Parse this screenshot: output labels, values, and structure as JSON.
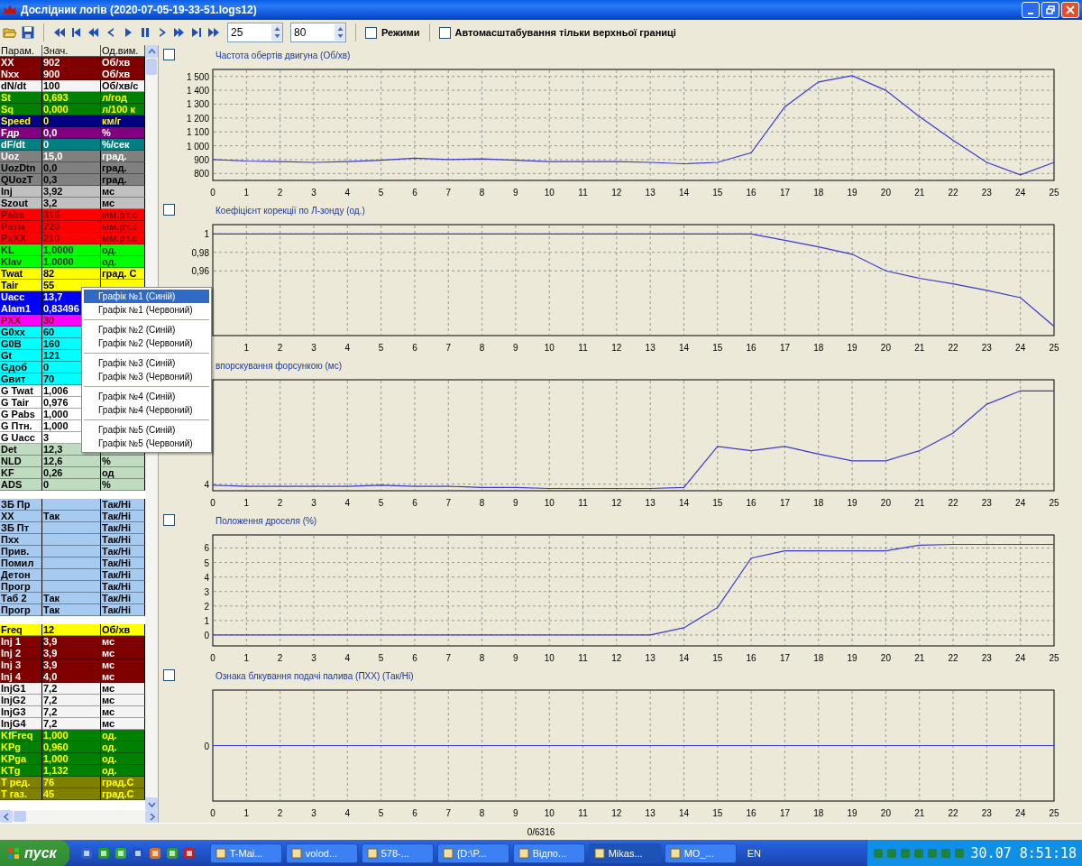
{
  "window": {
    "title": "Дослідник логів (2020-07-05-19-33-51.logs12)"
  },
  "toolbar": {
    "spin_fields": [
      {
        "value": "25"
      },
      {
        "value": "80"
      }
    ],
    "checkboxes": [
      {
        "label": "Режими",
        "checked": false
      },
      {
        "label": "Автомасштабування тільки верхньої границі",
        "checked": false
      }
    ]
  },
  "table": {
    "columns": [
      "Парам.",
      "Знач.",
      "Од.вим."
    ],
    "groups": [
      {
        "rows": [
          {
            "param": "XX",
            "value": "902",
            "unit": "Об/хв",
            "kind": "maroon"
          },
          {
            "param": "Nxx",
            "value": "900",
            "unit": "Об/хв",
            "kind": "maroon"
          },
          {
            "param": "dN/dt",
            "value": "100",
            "unit": "Об/хв/с",
            "kind": "light"
          },
          {
            "param": "St",
            "value": "0,693",
            "unit": "л/год",
            "kind": "green"
          },
          {
            "param": "Sq",
            "value": "0,000",
            "unit": "л/100 к",
            "kind": "green"
          },
          {
            "param": "Speed",
            "value": "0",
            "unit": "км/г",
            "kind": "navy"
          },
          {
            "param": "Fдр",
            "value": "0,0",
            "unit": "%",
            "kind": "purple"
          },
          {
            "param": "dF/dt",
            "value": "0",
            "unit": "%/сек",
            "kind": "teal"
          },
          {
            "param": "Uoz",
            "value": "15,0",
            "unit": "град.",
            "kind": "gray"
          },
          {
            "param": "UozDtn",
            "value": "0,0",
            "unit": "град.",
            "kind": "slate"
          },
          {
            "param": "QUozT",
            "value": "0,3",
            "unit": "град.",
            "kind": "slate"
          },
          {
            "param": "Inj",
            "value": "3,92",
            "unit": "мс",
            "kind": "silver"
          },
          {
            "param": "Szout",
            "value": "3,2",
            "unit": "мс",
            "kind": "silver"
          },
          {
            "param": "Pabs",
            "value": "315",
            "unit": "мм.рт.с",
            "kind": "red"
          },
          {
            "param": "Ратм",
            "value": "720",
            "unit": "мм.рт.с",
            "kind": "red"
          },
          {
            "param": "PxXX",
            "value": "210",
            "unit": "мм.рт.с",
            "kind": "red"
          },
          {
            "param": "KL",
            "value": "1,0000",
            "unit": "од.",
            "kind": "lime"
          },
          {
            "param": "Klav",
            "value": "1,0000",
            "unit": "од.",
            "kind": "lime"
          },
          {
            "param": "Twat",
            "value": "82",
            "unit": "град. С",
            "kind": "yellow"
          },
          {
            "param": "Tair",
            "value": "55",
            "kind": "yellow"
          },
          {
            "param": "Uacc",
            "value": "13,7",
            "kind": "blue"
          },
          {
            "param": "Alam1",
            "value": "0,83496",
            "kind": "blue"
          },
          {
            "param": "PXX",
            "value": "30",
            "kind": "magenta"
          },
          {
            "param": "G0xx",
            "value": "60",
            "kind": "cyan"
          },
          {
            "param": "G0B",
            "value": "160",
            "kind": "cyan"
          },
          {
            "param": "Gt",
            "value": "121",
            "kind": "cyan"
          },
          {
            "param": "Gдоб",
            "value": "0",
            "kind": "cyan"
          },
          {
            "param": "Gвит",
            "value": "70",
            "kind": "cyan"
          },
          {
            "param": "G Twat",
            "value": "1,006",
            "kind": "white"
          },
          {
            "param": "G Tair",
            "value": "0,976",
            "kind": "white"
          },
          {
            "param": "G Pabs",
            "value": "1,000",
            "kind": "white"
          },
          {
            "param": "G Птн.",
            "value": "1,000",
            "kind": "white"
          },
          {
            "param": "G Uacc",
            "value": "3",
            "kind": "white"
          },
          {
            "param": "Det",
            "value": "12,3",
            "kind": "sage"
          },
          {
            "param": "NLD",
            "value": "12,6",
            "unit": "%",
            "kind": "sage"
          },
          {
            "param": "KF",
            "value": "0,26",
            "unit": "од",
            "kind": "sage"
          },
          {
            "param": "ADS",
            "value": "0",
            "unit": "%",
            "kind": "sage"
          }
        ]
      },
      {
        "rows": [
          {
            "param": "ЗБ Пр",
            "unit": "Так/Ні",
            "kind": "sky"
          },
          {
            "param": "XX",
            "value": "Так",
            "unit": "Так/Ні",
            "kind": "sky"
          },
          {
            "param": "ЗБ Пт",
            "unit": "Так/Ні",
            "kind": "sky"
          },
          {
            "param": "Пхх",
            "unit": "Так/Ні",
            "kind": "sky"
          },
          {
            "param": "Прив.",
            "unit": "Так/Ні",
            "kind": "sky"
          },
          {
            "param": "Помил",
            "unit": "Так/Ні",
            "kind": "sky"
          },
          {
            "param": "Детон",
            "unit": "Так/Ні",
            "kind": "sky"
          },
          {
            "param": "Прогр",
            "unit": "Так/Ні",
            "kind": "sky"
          },
          {
            "param": "Таб 2",
            "value": "Так",
            "unit": "Так/Ні",
            "kind": "sky"
          },
          {
            "param": "Прогр",
            "value": "Так",
            "unit": "Так/Ні",
            "kind": "sky"
          }
        ]
      },
      {
        "rows": [
          {
            "param": "Freq",
            "value": "12",
            "unit": "Об/хв",
            "kind": "yellow"
          },
          {
            "param": "Inj 1",
            "value": "3,9",
            "unit": "мс",
            "kind": "maroon"
          },
          {
            "param": "Inj 2",
            "value": "3,9",
            "unit": "мс",
            "kind": "maroon"
          },
          {
            "param": "Inj 3",
            "value": "3,9",
            "unit": "мс",
            "kind": "maroon"
          },
          {
            "param": "Inj 4",
            "value": "4,0",
            "unit": "мс",
            "kind": "maroon"
          },
          {
            "param": "InjG1",
            "value": "7,2",
            "unit": "мс",
            "kind": "light"
          },
          {
            "param": "InjG2",
            "value": "7,2",
            "unit": "мс",
            "kind": "light"
          },
          {
            "param": "InjG3",
            "value": "7,2",
            "unit": "мс",
            "kind": "light"
          },
          {
            "param": "InjG4",
            "value": "7,2",
            "unit": "мс",
            "kind": "light"
          },
          {
            "param": "KfFreq",
            "value": "1,000",
            "unit": "од.",
            "kind": "green"
          },
          {
            "param": "KPg",
            "value": "0,960",
            "unit": "од.",
            "kind": "green"
          },
          {
            "param": "KPga",
            "value": "1,000",
            "unit": "од.",
            "kind": "green"
          },
          {
            "param": "KTg",
            "value": "1,132",
            "unit": "од.",
            "kind": "green"
          },
          {
            "param": "Т ред.",
            "value": "76",
            "unit": "град.С",
            "kind": "olive"
          },
          {
            "param": "Т газ.",
            "value": "45",
            "unit": "град.С",
            "kind": "olive"
          }
        ]
      }
    ]
  },
  "context_menu": {
    "groups": [
      {
        "items": [
          {
            "label": "Графік №1 (Синій)",
            "selected": true
          },
          {
            "label": "Графік №1 (Червоний)",
            "selected": false
          }
        ]
      },
      {
        "items": [
          {
            "label": "Графік №2 (Синій)",
            "selected": false
          },
          {
            "label": "Графік №2 (Червоний)",
            "selected": false
          }
        ]
      },
      {
        "items": [
          {
            "label": "Графік №3 (Синій)",
            "selected": false
          },
          {
            "label": "Графік №3 (Червоний)",
            "selected": false
          }
        ]
      },
      {
        "items": [
          {
            "label": "Графік №4 (Синій)",
            "selected": false
          },
          {
            "label": "Графік №4 (Червоний)",
            "selected": false
          }
        ]
      },
      {
        "items": [
          {
            "label": "Графік №5 (Синій)",
            "selected": false
          },
          {
            "label": "Графік №5 (Червоний)",
            "selected": false
          }
        ]
      }
    ]
  },
  "charts": [
    {
      "kind": "chart",
      "checked": false,
      "chart_data": {
        "type": "line",
        "title": "Частота обертів двигуна (Об/хв)",
        "grid": true,
        "x": [
          0,
          1,
          2,
          3,
          4,
          5,
          6,
          7,
          8,
          9,
          10,
          11,
          12,
          13,
          14,
          15,
          16,
          17,
          18,
          19,
          20,
          21,
          22,
          23,
          24,
          25
        ],
        "xlim": [
          0,
          25
        ],
        "xticks": [
          0,
          1,
          2,
          3,
          4,
          5,
          6,
          7,
          8,
          9,
          10,
          11,
          12,
          13,
          14,
          15,
          16,
          17,
          18,
          19,
          20,
          21,
          22,
          23,
          24,
          25
        ],
        "ylim": [
          750,
          1550
        ],
        "yticks": [
          {
            "value": 800,
            "label": "800"
          },
          {
            "value": 900,
            "label": "900"
          },
          {
            "value": 1000,
            "label": "1 000"
          },
          {
            "value": 1100,
            "label": "1 100"
          },
          {
            "value": 1200,
            "label": "1 200"
          },
          {
            "value": 1300,
            "label": "1 300"
          },
          {
            "value": 1400,
            "label": "1 400"
          },
          {
            "value": 1500,
            "label": "1 500"
          }
        ],
        "series": [
          {
            "color": "#3a3ad0",
            "values": [
              900,
              890,
              885,
              880,
              885,
              895,
              910,
              900,
              905,
              895,
              885,
              885,
              885,
              880,
              870,
              880,
              950,
              1280,
              1460,
              1505,
              1400,
              1210,
              1040,
              880,
              790,
              880
            ]
          }
        ]
      }
    },
    {
      "kind": "chart",
      "checked": false,
      "chart_data": {
        "type": "line",
        "title": "Коефіцієнт корекції по Л-зонду (од.)",
        "grid": true,
        "x": [
          0,
          1,
          2,
          3,
          4,
          5,
          6,
          7,
          8,
          9,
          10,
          11,
          12,
          13,
          14,
          15,
          16,
          17,
          18,
          19,
          20,
          21,
          22,
          23,
          24,
          25
        ],
        "xlim": [
          0,
          25
        ],
        "xticks": [
          1,
          2,
          3,
          4,
          5,
          6,
          7,
          8,
          9,
          10,
          11,
          12,
          13,
          14,
          15,
          16,
          17,
          18,
          19,
          20,
          21,
          22,
          23,
          24,
          25
        ],
        "ylim": [
          0.89,
          1.01
        ],
        "yticks": [
          {
            "value": 0.96,
            "label": "0,96"
          },
          {
            "value": 0.98,
            "label": "0,98"
          },
          {
            "value": 1,
            "label": "1"
          }
        ],
        "series": [
          {
            "color": "#3a3ad0",
            "values": [
              1,
              1,
              1,
              1,
              1,
              1,
              1,
              1,
              1,
              1,
              1,
              1,
              1,
              1,
              1,
              1,
              1,
              0.993,
              0.986,
              0.978,
              0.96,
              0.952,
              0.946,
              0.939,
              0.931,
              0.9
            ]
          }
        ]
      }
    },
    {
      "kind": "rising",
      "title": "впорскування форсункою (мс)",
      "x_labels": [
        "0",
        "1",
        "2",
        "3",
        "4",
        "5",
        "6",
        "7",
        "8",
        "9",
        "10",
        "11",
        "12",
        "13",
        "14",
        "15",
        "16",
        "17",
        "18",
        "19",
        "20",
        "21",
        "22",
        "23",
        "24",
        "25"
      ],
      "y_labels": [
        "4"
      ]
    },
    {
      "kind": "chart",
      "checked": false,
      "chart_data": {
        "type": "line",
        "title": "Положення дроселя (%)",
        "grid": true,
        "x": [
          0,
          1,
          2,
          3,
          4,
          5,
          6,
          7,
          8,
          9,
          10,
          11,
          12,
          13,
          14,
          15,
          16,
          17,
          18,
          19,
          20,
          21,
          22,
          23,
          24,
          25
        ],
        "xlim": [
          0,
          25
        ],
        "xticks": [
          0,
          1,
          2,
          3,
          4,
          5,
          6,
          7,
          8,
          9,
          10,
          11,
          12,
          13,
          14,
          15,
          16,
          17,
          18,
          19,
          20,
          21,
          22,
          23,
          24,
          25
        ],
        "ylim": [
          -0.75,
          6.9
        ],
        "yticks": [
          0,
          1,
          2,
          3,
          4,
          5,
          6
        ],
        "series": [
          {
            "color": "#3a3ad0",
            "values": [
              0,
              0,
              0,
              0,
              0,
              0,
              0,
              0,
              0,
              0,
              0,
              0,
              0,
              0,
              0.5,
              1.9,
              5.3,
              5.8,
              5.8,
              5.8,
              5.8,
              6.2,
              6.25,
              6.25,
              6.25,
              6.25
            ]
          }
        ]
      }
    },
    {
      "kind": "flat",
      "checked": false,
      "title": "Ознака блкування подачі палива (ПХХ) (Так/Ні)",
      "x_labels": [
        "0",
        "1",
        "2",
        "3",
        "4",
        "5",
        "6",
        "7",
        "8",
        "9",
        "10",
        "11",
        "12",
        "13",
        "14",
        "15",
        "16",
        "17",
        "18",
        "19",
        "20",
        "21",
        "22",
        "23",
        "24",
        "25"
      ],
      "y_labels": [
        "0"
      ]
    }
  ],
  "status_bar": {
    "position": "0/6316"
  },
  "taskbar": {
    "start": "пуск",
    "tasks": [
      {
        "label": "T-Mai...",
        "selected": false
      },
      {
        "label": "volod...",
        "selected": false
      },
      {
        "label": "578-...",
        "selected": false
      },
      {
        "label": "{D:\\P...",
        "selected": false
      },
      {
        "label": "Відпо...",
        "selected": false
      },
      {
        "label": "Mikas...",
        "selected": true
      },
      {
        "label": "MO_...",
        "selected": false
      }
    ],
    "language": "EN",
    "clock": "30.07 8:51:18"
  }
}
